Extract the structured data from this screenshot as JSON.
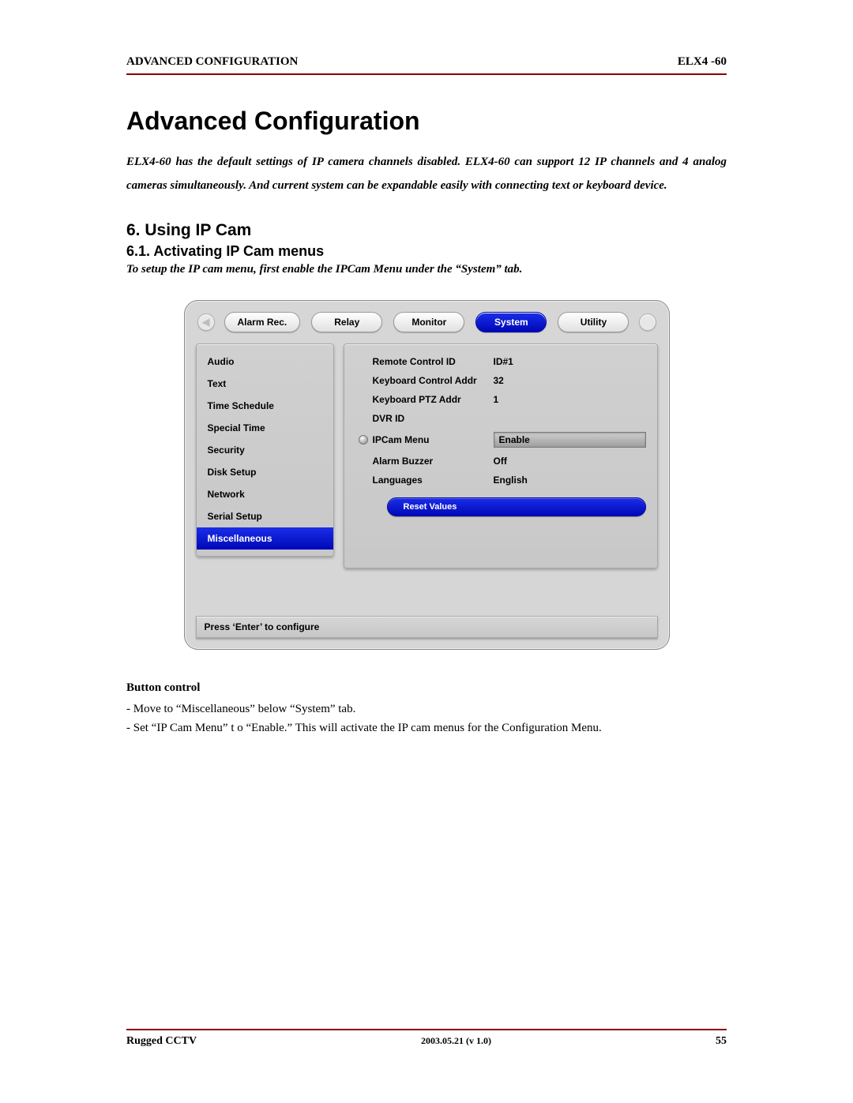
{
  "header": {
    "left": "ADVANCED CONFIGURATION",
    "right": "ELX4 -60"
  },
  "title": "Advanced Configuration",
  "intro": "ELX4-60 has the default settings of IP camera channels disabled. ELX4-60 can support 12 IP channels and 4 analog cameras simultaneously. And current system can be expandable easily with connecting text or keyboard device.",
  "section": {
    "num_title": "6.  Using IP Cam",
    "sub_title": "6.1.  Activating IP Cam menus"
  },
  "setup_line": "To setup the IP cam menu, first enable the IPCam Menu under the “System” tab.",
  "shot": {
    "tabs": [
      "Alarm Rec.",
      "Relay",
      "Monitor",
      "System",
      "Utility"
    ],
    "active_tab_index": 3,
    "sidebar": [
      "Audio",
      "Text",
      "Time Schedule",
      "Special Time",
      "Security",
      "Disk Setup",
      "Network",
      "Serial Setup",
      "Miscellaneous"
    ],
    "sidebar_selected_index": 8,
    "rows": [
      {
        "label": "Remote Control ID",
        "value": "ID#1",
        "indicator": false,
        "highlight": false
      },
      {
        "label": "Keyboard Control Addr",
        "value": "32",
        "indicator": false,
        "highlight": false
      },
      {
        "label": "Keyboard PTZ Addr",
        "value": "1",
        "indicator": false,
        "highlight": false
      },
      {
        "label": "DVR ID",
        "value": "",
        "indicator": false,
        "highlight": false
      },
      {
        "label": "IPCam Menu",
        "value": "Enable",
        "indicator": true,
        "highlight": true
      },
      {
        "label": "Alarm Buzzer",
        "value": "Off",
        "indicator": false,
        "highlight": false
      },
      {
        "label": "Languages",
        "value": "English",
        "indicator": false,
        "highlight": false
      }
    ],
    "reset_label": "Reset Values",
    "status": "Press ‘Enter’ to configure"
  },
  "button_control": {
    "heading": "Button control",
    "lines": [
      "- Move to “Miscellaneous” below “System” tab.",
      "- Set “IP Cam Menu” t o “Enable.” This will activate the IP cam menus for the Configuration Menu."
    ]
  },
  "footer": {
    "left": "Rugged CCTV",
    "center": "2003.05.21 (v 1.0)",
    "right": "55"
  }
}
